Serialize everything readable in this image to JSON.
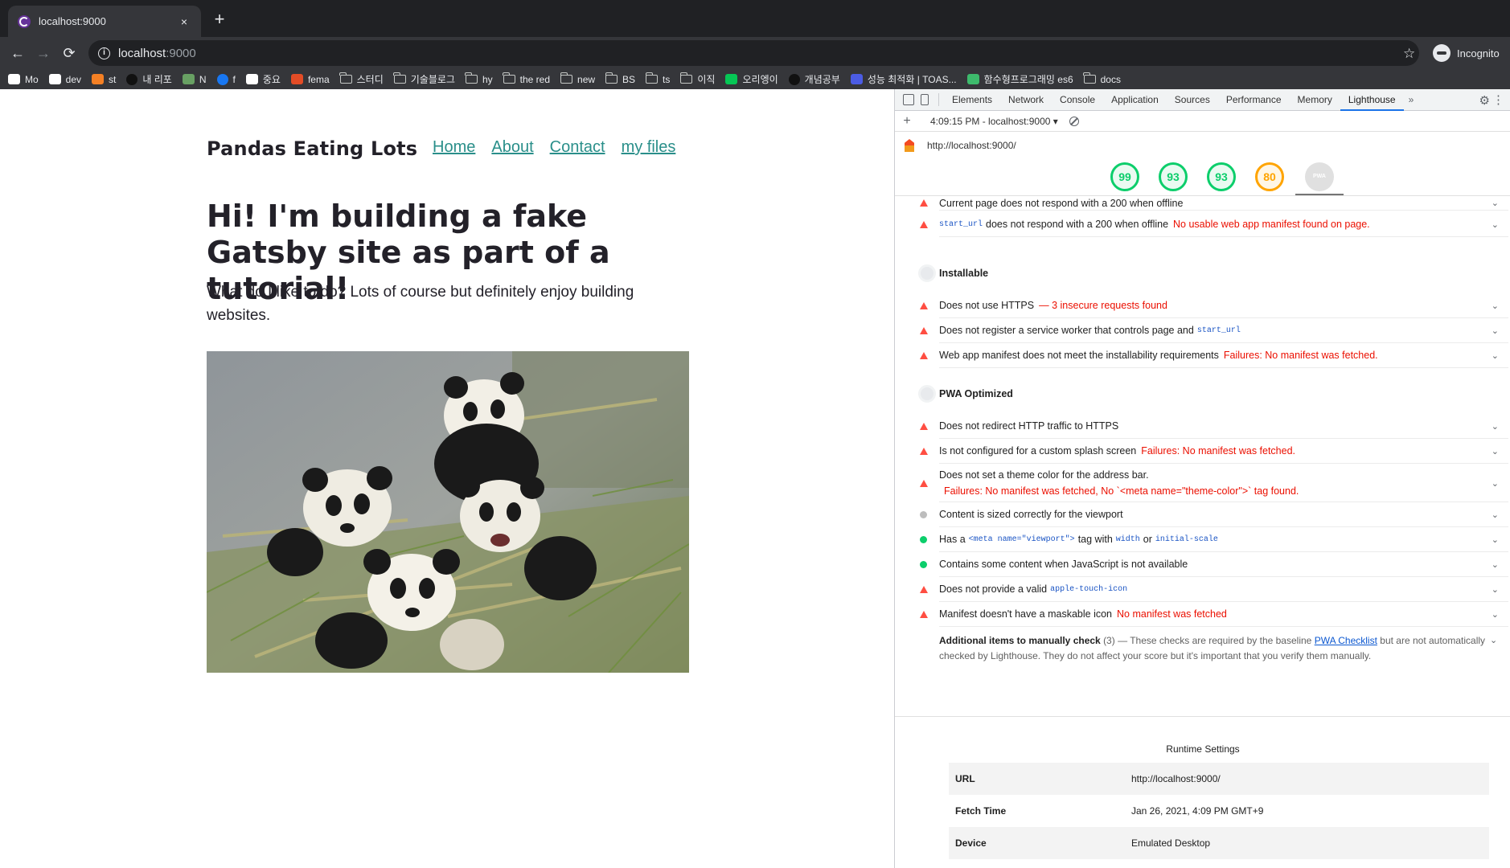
{
  "browser": {
    "tab_title": "localhost:9000",
    "tab_close": "×",
    "new_tab": "+",
    "url_host": "localhost",
    "url_port": ":9000",
    "profile_label": "Incognito",
    "bookmarks": [
      {
        "label": "Mo",
        "icon": "medium-icon",
        "color": "#ffffff"
      },
      {
        "label": "dev",
        "icon": "dev-icon",
        "color": "#ffffff"
      },
      {
        "label": "st",
        "icon": "stackoverflow-icon",
        "color": "#f48024"
      },
      {
        "label": "내 리포",
        "icon": "github-icon",
        "color": "#111111"
      },
      {
        "label": "N",
        "icon": "node-icon",
        "color": "#68a063"
      },
      {
        "label": "f",
        "icon": "facebook-icon",
        "color": "#1877f2"
      },
      {
        "label": "중요",
        "icon": "medium-dots-icon",
        "color": "#ffffff"
      },
      {
        "label": "fema",
        "icon": "fm-icon",
        "color": "#e34c26"
      },
      {
        "label": "스터디",
        "icon": "folder-icon",
        "color": "#c4c7c5"
      },
      {
        "label": "기술블로그",
        "icon": "folder-icon",
        "color": "#c4c7c5"
      },
      {
        "label": "hy",
        "icon": "folder-icon",
        "color": "#c4c7c5"
      },
      {
        "label": "the red",
        "icon": "folder-icon",
        "color": "#c4c7c5"
      },
      {
        "label": "new",
        "icon": "folder-icon",
        "color": "#c4c7c5"
      },
      {
        "label": "BS",
        "icon": "folder-icon",
        "color": "#c4c7c5"
      },
      {
        "label": "ts",
        "icon": "folder-icon",
        "color": "#c4c7c5"
      },
      {
        "label": "이직",
        "icon": "folder-icon",
        "color": "#c4c7c5"
      },
      {
        "label": "오리엥이",
        "icon": "line-icon",
        "color": "#06c755"
      },
      {
        "label": "개념공부",
        "icon": "github-icon",
        "color": "#111111"
      },
      {
        "label": "성능 최적화 | TOAS...",
        "icon": "toast-icon",
        "color": "#4b5ce4"
      },
      {
        "label": "함수형프로그래밍 es6",
        "icon": "green-icon",
        "color": "#3dba6c"
      },
      {
        "label": "docs",
        "icon": "folder-icon",
        "color": "#c4c7c5"
      }
    ]
  },
  "site": {
    "title": "Pandas Eating Lots",
    "nav": [
      "Home",
      "About",
      "Contact",
      "my files"
    ],
    "heading": "Hi! I'm building a fake Gatsby site as part of a tutorial!",
    "intro": "What do I like to do? Lots of course but definitely enjoy building websites."
  },
  "devtools": {
    "tabs": [
      "Elements",
      "Network",
      "Console",
      "Application",
      "Sources",
      "Performance",
      "Memory",
      "Lighthouse"
    ],
    "active_tab": "Lighthouse",
    "more": "»",
    "run_label": "4:09:15 PM - localhost:9000 ▾",
    "report_url": "http://localhost:9000/",
    "scores": [
      {
        "value": "99",
        "status": "pass"
      },
      {
        "value": "93",
        "status": "pass"
      },
      {
        "value": "93",
        "status": "pass"
      },
      {
        "value": "80",
        "status": "average"
      },
      {
        "value": "PWA",
        "status": "pwa"
      }
    ],
    "colors": {
      "pass": "#0cce6b",
      "average": "#ffa400",
      "fail": "#ff4e42",
      "error_text": "#eb0f00"
    },
    "audits_top": [
      {
        "status": "fail",
        "text": "Current page does not respond with a 200 when offline",
        "error": ""
      },
      {
        "status": "fail",
        "code": "start_url",
        "text": "does not respond with a 200 when offline",
        "error": "No usable web app manifest found on page."
      }
    ],
    "installable_title": "Installable",
    "installable": [
      {
        "status": "fail",
        "text": "Does not use HTTPS",
        "error": "— 3 insecure requests found"
      },
      {
        "status": "fail",
        "text": "Does not register a service worker that controls page and",
        "code": "start_url"
      },
      {
        "status": "fail",
        "text": "Web app manifest does not meet the installability requirements",
        "error": "Failures: No manifest was fetched."
      }
    ],
    "pwa_title": "PWA Optimized",
    "pwa": [
      {
        "status": "fail",
        "text": "Does not redirect HTTP traffic to HTTPS"
      },
      {
        "status": "fail",
        "text": "Is not configured for a custom splash screen",
        "error": "Failures: No manifest was fetched."
      },
      {
        "status": "fail",
        "text": "Does not set a theme color for the address bar.",
        "error": "Failures: No manifest was fetched, No `<meta name=\"theme-color\">` tag found."
      },
      {
        "status": "na",
        "text": "Content is sized correctly for the viewport"
      },
      {
        "status": "pass",
        "text_before": "Has a",
        "code": "<meta name=\"viewport\">",
        "text_mid": "tag with",
        "code2": "width",
        "text_or": "or",
        "code3": "initial-scale"
      },
      {
        "status": "pass",
        "text": "Contains some content when JavaScript is not available"
      },
      {
        "status": "fail",
        "text": "Does not provide a valid",
        "code": "apple-touch-icon"
      },
      {
        "status": "fail",
        "text": "Manifest doesn't have a maskable icon",
        "error": "No manifest was fetched"
      }
    ],
    "manual": {
      "title": "Additional items to manually check",
      "count": "(3)",
      "dash": "—",
      "text_before": "These checks are required by the baseline",
      "link": "PWA Checklist",
      "text_after": "but are not automatically checked by Lighthouse. They do not affect your score but it's important that you verify them manually."
    },
    "runtime": {
      "title": "Runtime Settings",
      "rows": [
        {
          "key": "URL",
          "value": "http://localhost:9000/"
        },
        {
          "key": "Fetch Time",
          "value": "Jan 26, 2021, 4:09 PM GMT+9"
        },
        {
          "key": "Device",
          "value": "Emulated Desktop"
        }
      ]
    }
  }
}
